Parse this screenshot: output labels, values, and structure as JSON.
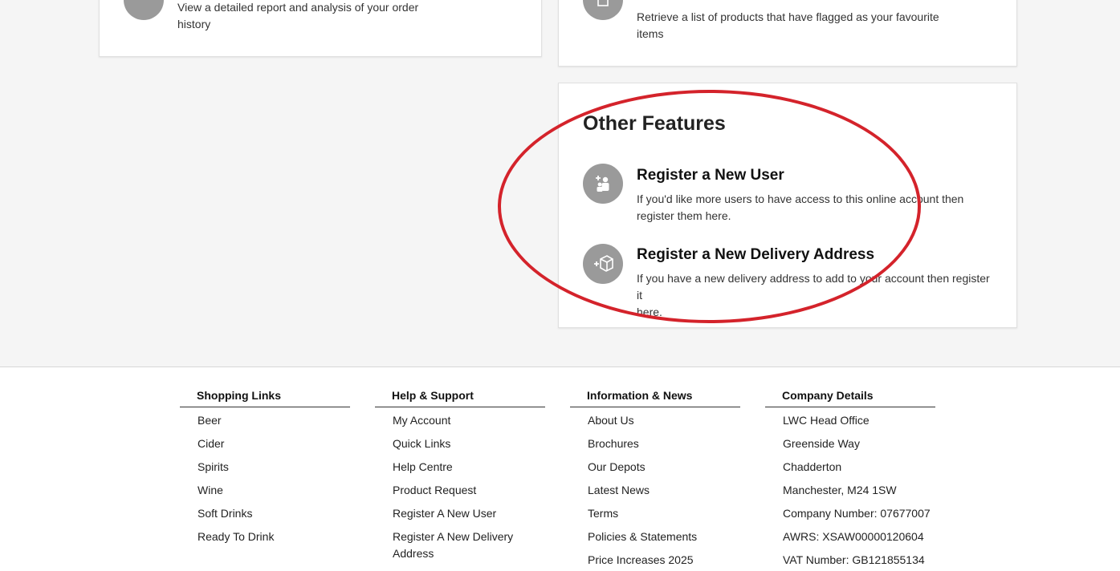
{
  "order_card": {
    "desc_line1": "View a detailed report and analysis of your order",
    "desc_line2": "history"
  },
  "favourites_card": {
    "desc_line1": "Retrieve a list of products that have flagged as your favourite",
    "desc_line2": "items"
  },
  "other_features": {
    "title": "Other Features",
    "items": [
      {
        "title": "Register a New User",
        "desc_line1": "If you'd like more users to have access to this online account then",
        "desc_line2": "register them here.",
        "icon": "add-user-icon"
      },
      {
        "title": "Register a New Delivery Address",
        "desc_line1": "If you have a new delivery address to add to your account then register it",
        "desc_line2": "here.",
        "icon": "add-package-icon"
      }
    ]
  },
  "annotation": {
    "color": "#d4232b"
  },
  "footer": {
    "columns": [
      {
        "heading": "Shopping Links",
        "links": [
          "Beer",
          "Cider",
          "Spirits",
          "Wine",
          "Soft Drinks",
          "Ready To Drink"
        ]
      },
      {
        "heading": "Help & Support",
        "links": [
          "My Account",
          "Quick Links",
          "Help Centre",
          "Product Request",
          "Register A New User",
          "Register A New Delivery Address"
        ]
      },
      {
        "heading": "Information & News",
        "links": [
          "About Us",
          "Brochures",
          "Our Depots",
          "Latest News",
          "Terms",
          "Policies & Statements",
          "Price Increases 2025"
        ]
      },
      {
        "heading": "Company Details",
        "links": [
          "LWC Head Office",
          "Greenside Way",
          "Chadderton",
          "Manchester, M24 1SW",
          "Company Number: 07677007",
          "AWRS: XSAW00000120604",
          "VAT Number: GB121855134"
        ]
      }
    ]
  }
}
